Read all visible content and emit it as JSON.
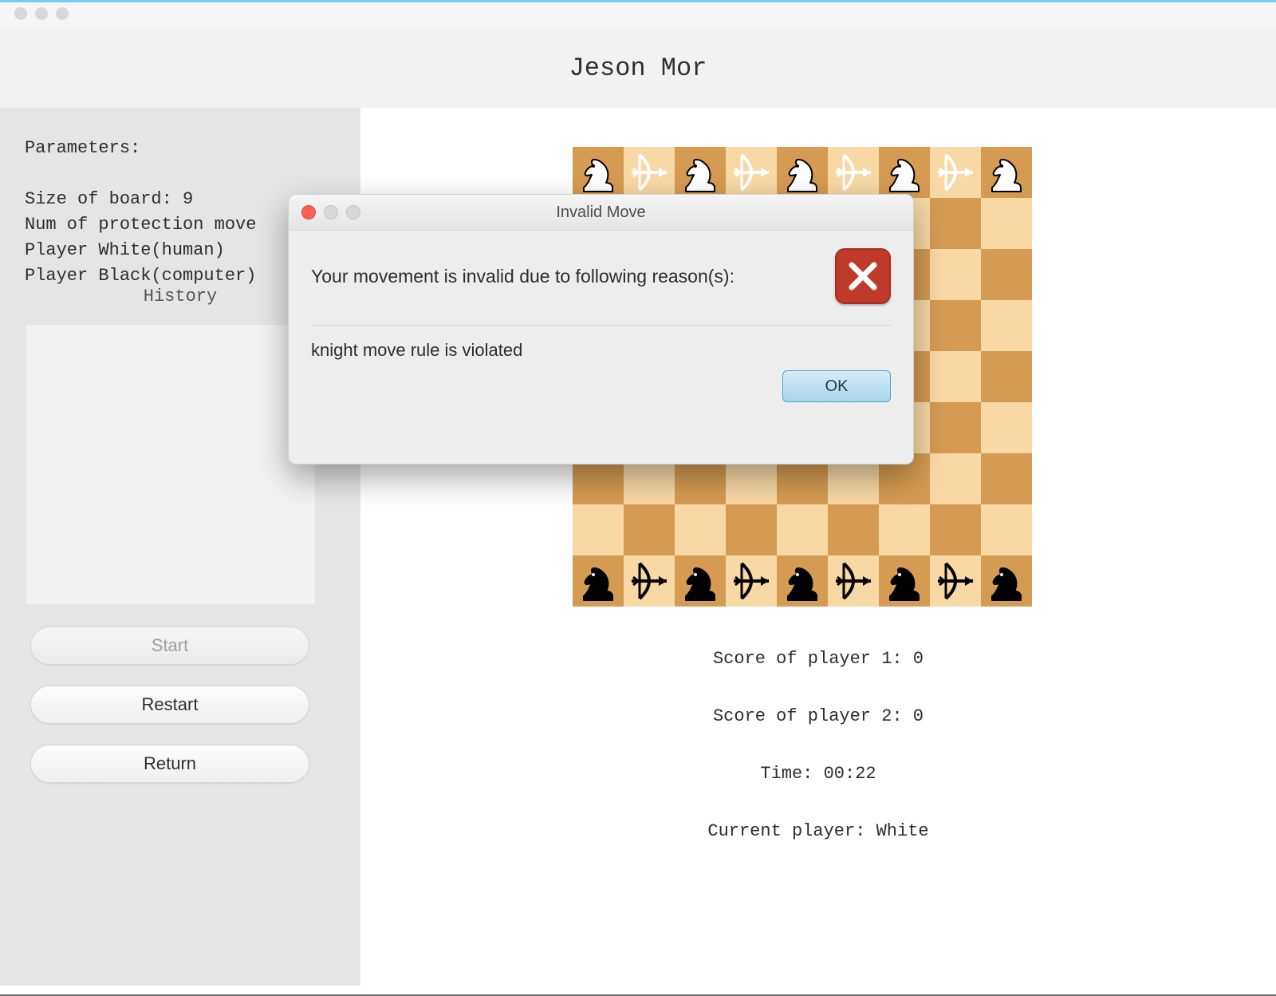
{
  "app": {
    "title": "Jeson Mor"
  },
  "parameters": {
    "label": "Parameters:",
    "lines": [
      "Size of board: 9",
      "Num of protection move",
      "Player White(human)",
      "Player Black(computer)"
    ]
  },
  "history": {
    "label": "History"
  },
  "buttons": {
    "start": "Start",
    "restart": "Restart",
    "return": "Return"
  },
  "status": {
    "score1_label": "Score of player 1:",
    "score1_value": "0",
    "score2_label": "Score of player 2:",
    "score2_value": "0",
    "time_label": "Time:",
    "time_value": "00:22",
    "turn_label": "Current player:",
    "turn_value": "White"
  },
  "board": {
    "size": 9,
    "top_row_pieces": [
      "knight-white",
      "archer-white",
      "knight-white",
      "archer-white",
      "knight-white",
      "archer-white",
      "knight-white",
      "archer-white",
      "knight-white"
    ],
    "bottom_row_pieces": [
      "knight-black",
      "archer-black",
      "knight-black",
      "archer-black",
      "knight-black",
      "archer-black",
      "knight-black",
      "archer-black",
      "knight-black"
    ]
  },
  "modal": {
    "title": "Invalid Move",
    "header": "Your movement is invalid due to following reason(s):",
    "reason": "knight move rule is violated",
    "ok": "OK",
    "icon": "error-x-icon"
  },
  "colors": {
    "board_light": "#f8d9a6",
    "board_dark": "#d59b52",
    "accent_blue": "#7ac8f0",
    "error_red": "#c0392b"
  }
}
